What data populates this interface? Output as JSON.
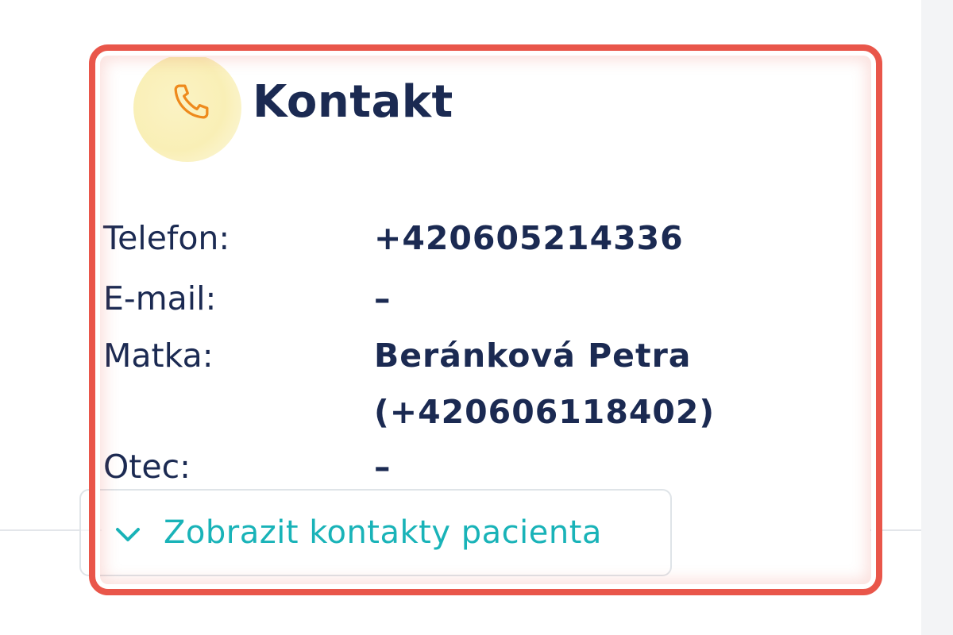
{
  "card": {
    "title": "Kontakt",
    "icon": "phone-icon",
    "accent_color": "#f0a030",
    "icon_bg_color": "#f9efb6"
  },
  "fields": {
    "phone": {
      "label": "Telefon:",
      "value": "+420605214336"
    },
    "email": {
      "label": "E-mail:",
      "value": "–"
    },
    "mother": {
      "label": "Matka:",
      "value_line1": "Beránková Petra",
      "value_line2": "(+420606118402)"
    },
    "father": {
      "label": "Otec:",
      "value": "–"
    }
  },
  "expand_button": {
    "label": "Zobrazit kontakty pacienta",
    "icon": "chevron-down-icon",
    "color": "#19b3b8"
  },
  "highlight_color": "#e9564a"
}
